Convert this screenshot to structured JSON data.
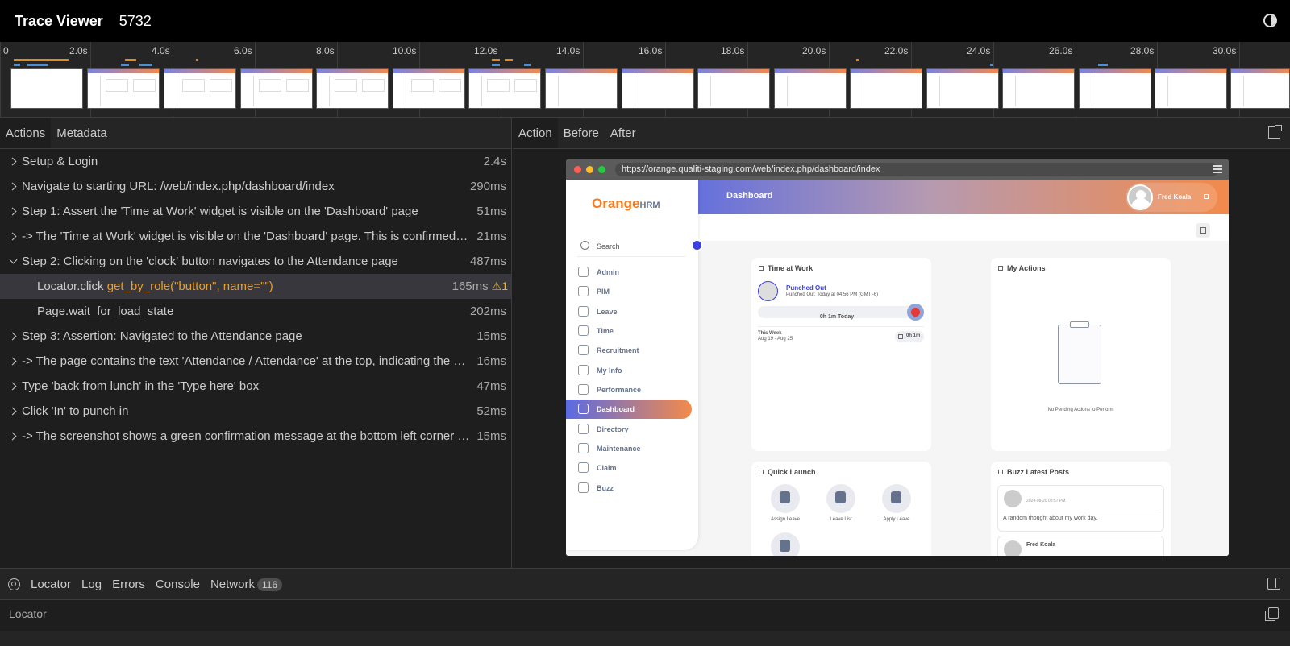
{
  "app": {
    "title": "Trace Viewer",
    "trace_id": "5732"
  },
  "timeline": {
    "ticks": [
      "0",
      "2.0s",
      "4.0s",
      "6.0s",
      "8.0s",
      "10.0s",
      "12.0s",
      "14.0s",
      "16.0s",
      "18.0s",
      "20.0s",
      "22.0s",
      "24.0s",
      "26.0s",
      "28.0s",
      "30.0s"
    ]
  },
  "left_panel": {
    "tabs": [
      "Actions",
      "Metadata"
    ],
    "actions": [
      {
        "title": "Setup & Login",
        "time": "2.4s"
      },
      {
        "title": "Navigate to starting URL: /web/index.php/dashboard/index",
        "time": "290ms"
      },
      {
        "title": "Step 1: Assert the 'Time at Work' widget is visible on the 'Dashboard' page",
        "time": "51ms"
      },
      {
        "title": "-> The 'Time at Work' widget is visible on the 'Dashboard' page. This is confirmed by the presence of the widget",
        "time": "21ms"
      },
      {
        "title": "Step 2: Clicking on the 'clock' button navigates to the Attendance page",
        "time": "487ms"
      },
      {
        "api": "Locator.click",
        "locator": "get_by_role(\"button\", name=\"\")",
        "time": "165ms",
        "warnings": "1"
      },
      {
        "api": "Page.wait_for_load_state",
        "time": "202ms"
      },
      {
        "title": "Step 3: Assertion: Navigated to the Attendance page",
        "time": "15ms"
      },
      {
        "title": "-> The page contains the text 'Attendance / Attendance' at the top, indicating the user is on the Attendance page",
        "time": "16ms"
      },
      {
        "title": "Type 'back from lunch' in the 'Type here' box",
        "time": "47ms"
      },
      {
        "title": "Click 'In' to punch in",
        "time": "52ms"
      },
      {
        "title": "-> The screenshot shows a green confirmation message at the bottom left corner of the page",
        "time": "15ms"
      }
    ]
  },
  "right_panel": {
    "tabs": [
      "Action",
      "Before",
      "After"
    ],
    "browser": {
      "url": "https://orange.qualiti-staging.com/web/index.php/dashboard/index",
      "header_title": "Dashboard",
      "user_name": "Fred Koala",
      "logo_main": "Orange",
      "logo_sub": "HRM",
      "search_label": "Search",
      "nav": [
        "Admin",
        "PIM",
        "Leave",
        "Time",
        "Recruitment",
        "My Info",
        "Performance",
        "Dashboard",
        "Directory",
        "Maintenance",
        "Claim",
        "Buzz"
      ],
      "time_at_work": {
        "title": "Time at Work",
        "status": "Punched Out",
        "detail": "Punched Out: Today at 04:56 PM (GMT -6)",
        "today": "0h 1m Today",
        "week_label": "This Week",
        "week_range": "Aug 19 - Aug 25",
        "week_total": "0h 1m"
      },
      "my_actions": {
        "title": "My Actions",
        "empty": "No Pending Actions to Perform"
      },
      "quick_launch": {
        "title": "Quick Launch",
        "items": [
          "Assign Leave",
          "Leave List",
          "Apply Leave"
        ]
      },
      "buzz": {
        "title": "Buzz Latest Posts",
        "post_author": "Fred Koala",
        "post_date": "2024-08-20 08:57 PM",
        "post_text": "A random thought about my work day.",
        "next_author": "Fred Koala"
      }
    }
  },
  "bottom_panel": {
    "tabs": [
      "Locator",
      "Log",
      "Errors",
      "Console",
      "Network"
    ],
    "network_count": "116",
    "locator_label": "Locator"
  }
}
